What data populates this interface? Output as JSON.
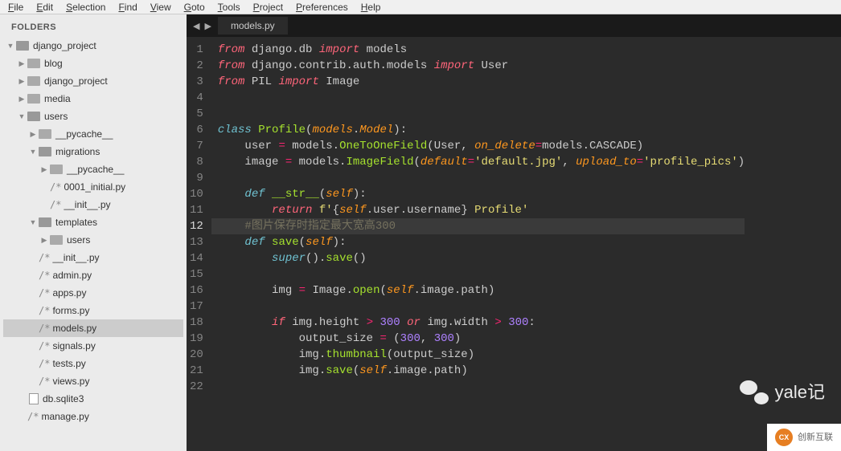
{
  "menu": [
    "File",
    "Edit",
    "Selection",
    "Find",
    "View",
    "Goto",
    "Tools",
    "Project",
    "Preferences",
    "Help"
  ],
  "sidebar": {
    "title": "FOLDERS",
    "tree": [
      {
        "type": "folder",
        "label": "django_project",
        "indent": 0,
        "open": true,
        "arrow": "down"
      },
      {
        "type": "folder",
        "label": "blog",
        "indent": 1,
        "open": false,
        "arrow": "right"
      },
      {
        "type": "folder",
        "label": "django_project",
        "indent": 1,
        "open": false,
        "arrow": "right"
      },
      {
        "type": "folder",
        "label": "media",
        "indent": 1,
        "open": false,
        "arrow": "right"
      },
      {
        "type": "folder",
        "label": "users",
        "indent": 1,
        "open": true,
        "arrow": "down"
      },
      {
        "type": "folder",
        "label": "__pycache__",
        "indent": 2,
        "open": false,
        "arrow": "right"
      },
      {
        "type": "folder",
        "label": "migrations",
        "indent": 2,
        "open": true,
        "arrow": "down"
      },
      {
        "type": "folder",
        "label": "__pycache__",
        "indent": 3,
        "open": false,
        "arrow": "right"
      },
      {
        "type": "file",
        "label": "0001_initial.py",
        "indent": 3,
        "prefix": "/*"
      },
      {
        "type": "file",
        "label": "__init__.py",
        "indent": 3,
        "prefix": "/*"
      },
      {
        "type": "folder",
        "label": "templates",
        "indent": 2,
        "open": true,
        "arrow": "down"
      },
      {
        "type": "folder",
        "label": "users",
        "indent": 3,
        "open": false,
        "arrow": "right"
      },
      {
        "type": "file",
        "label": "__init__.py",
        "indent": 2,
        "prefix": "/*"
      },
      {
        "type": "file",
        "label": "admin.py",
        "indent": 2,
        "prefix": "/*"
      },
      {
        "type": "file",
        "label": "apps.py",
        "indent": 2,
        "prefix": "/*"
      },
      {
        "type": "file",
        "label": "forms.py",
        "indent": 2,
        "prefix": "/*"
      },
      {
        "type": "file",
        "label": "models.py",
        "indent": 2,
        "prefix": "/*",
        "selected": true
      },
      {
        "type": "file",
        "label": "signals.py",
        "indent": 2,
        "prefix": "/*"
      },
      {
        "type": "file",
        "label": "tests.py",
        "indent": 2,
        "prefix": "/*"
      },
      {
        "type": "file",
        "label": "views.py",
        "indent": 2,
        "prefix": "/*"
      },
      {
        "type": "file",
        "label": "db.sqlite3",
        "indent": 1,
        "prefix": "",
        "icon": "file"
      },
      {
        "type": "file",
        "label": "manage.py",
        "indent": 1,
        "prefix": "/*"
      }
    ]
  },
  "tabs": {
    "active": "models.py"
  },
  "code": {
    "lines": [
      {
        "n": 1,
        "tokens": [
          [
            "kw",
            "from"
          ],
          [
            "name",
            " django"
          ],
          [
            "punct",
            "."
          ],
          [
            "name",
            "db"
          ],
          [
            "name",
            " "
          ],
          [
            "kw",
            "import"
          ],
          [
            "name",
            " models"
          ]
        ]
      },
      {
        "n": 2,
        "tokens": [
          [
            "kw",
            "from"
          ],
          [
            "name",
            " django"
          ],
          [
            "punct",
            "."
          ],
          [
            "name",
            "contrib"
          ],
          [
            "punct",
            "."
          ],
          [
            "name",
            "auth"
          ],
          [
            "punct",
            "."
          ],
          [
            "name",
            "models"
          ],
          [
            "name",
            " "
          ],
          [
            "kw",
            "import"
          ],
          [
            "name",
            " User"
          ]
        ]
      },
      {
        "n": 3,
        "tokens": [
          [
            "kw",
            "from"
          ],
          [
            "name",
            " PIL"
          ],
          [
            "name",
            " "
          ],
          [
            "kw",
            "import"
          ],
          [
            "name",
            " Image"
          ]
        ]
      },
      {
        "n": 4,
        "tokens": []
      },
      {
        "n": 5,
        "tokens": []
      },
      {
        "n": 6,
        "tokens": [
          [
            "kw2",
            "class"
          ],
          [
            "name",
            " "
          ],
          [
            "cls",
            "Profile"
          ],
          [
            "punct",
            "("
          ],
          [
            "param",
            "models"
          ],
          [
            "punct",
            "."
          ],
          [
            "param",
            "Model"
          ],
          [
            "punct",
            ")"
          ],
          [
            "punct",
            ":"
          ]
        ]
      },
      {
        "n": 7,
        "tokens": [
          [
            "name",
            "    user "
          ],
          [
            "op",
            "="
          ],
          [
            "name",
            " models"
          ],
          [
            "punct",
            "."
          ],
          [
            "fn",
            "OneToOneField"
          ],
          [
            "punct",
            "("
          ],
          [
            "name",
            "User"
          ],
          [
            "punct",
            ", "
          ],
          [
            "param",
            "on_delete"
          ],
          [
            "op",
            "="
          ],
          [
            "name",
            "models"
          ],
          [
            "punct",
            "."
          ],
          [
            "name",
            "CASCADE"
          ],
          [
            "punct",
            ")"
          ]
        ]
      },
      {
        "n": 8,
        "tokens": [
          [
            "name",
            "    image "
          ],
          [
            "op",
            "="
          ],
          [
            "name",
            " models"
          ],
          [
            "punct",
            "."
          ],
          [
            "fn",
            "ImageField"
          ],
          [
            "punct",
            "("
          ],
          [
            "param",
            "default"
          ],
          [
            "op",
            "="
          ],
          [
            "str",
            "'default.jpg'"
          ],
          [
            "punct",
            ", "
          ],
          [
            "param",
            "upload_to"
          ],
          [
            "op",
            "="
          ],
          [
            "str",
            "'profile_pics'"
          ],
          [
            "punct",
            ")"
          ]
        ]
      },
      {
        "n": 9,
        "tokens": []
      },
      {
        "n": 10,
        "tokens": [
          [
            "name",
            "    "
          ],
          [
            "kw2",
            "def"
          ],
          [
            "name",
            " "
          ],
          [
            "fn",
            "__str__"
          ],
          [
            "punct",
            "("
          ],
          [
            "param",
            "self"
          ],
          [
            "punct",
            ")"
          ],
          [
            "punct",
            ":"
          ]
        ]
      },
      {
        "n": 11,
        "tokens": [
          [
            "name",
            "        "
          ],
          [
            "kw",
            "return"
          ],
          [
            "name",
            " "
          ],
          [
            "str",
            "f'"
          ],
          [
            "punct",
            "{"
          ],
          [
            "param",
            "self"
          ],
          [
            "punct",
            "."
          ],
          [
            "name",
            "user"
          ],
          [
            "punct",
            "."
          ],
          [
            "name",
            "username"
          ],
          [
            "punct",
            "}"
          ],
          [
            "str",
            " Profile'"
          ]
        ]
      },
      {
        "n": 12,
        "cur": true,
        "tokens": [
          [
            "name",
            "    "
          ],
          [
            "comment",
            "#图片保存时指定最大宽高300"
          ]
        ]
      },
      {
        "n": 13,
        "tokens": [
          [
            "name",
            "    "
          ],
          [
            "kw2",
            "def"
          ],
          [
            "name",
            " "
          ],
          [
            "fn",
            "save"
          ],
          [
            "punct",
            "("
          ],
          [
            "param",
            "self"
          ],
          [
            "punct",
            ")"
          ],
          [
            "punct",
            ":"
          ]
        ]
      },
      {
        "n": 14,
        "tokens": [
          [
            "name",
            "        "
          ],
          [
            "builtin",
            "super"
          ],
          [
            "punct",
            "()"
          ],
          [
            "punct",
            "."
          ],
          [
            "fn",
            "save"
          ],
          [
            "punct",
            "()"
          ]
        ]
      },
      {
        "n": 15,
        "tokens": []
      },
      {
        "n": 16,
        "tokens": [
          [
            "name",
            "        img "
          ],
          [
            "op",
            "="
          ],
          [
            "name",
            " Image"
          ],
          [
            "punct",
            "."
          ],
          [
            "fn",
            "open"
          ],
          [
            "punct",
            "("
          ],
          [
            "param",
            "self"
          ],
          [
            "punct",
            "."
          ],
          [
            "name",
            "image"
          ],
          [
            "punct",
            "."
          ],
          [
            "name",
            "path"
          ],
          [
            "punct",
            ")"
          ]
        ]
      },
      {
        "n": 17,
        "tokens": []
      },
      {
        "n": 18,
        "tokens": [
          [
            "name",
            "        "
          ],
          [
            "kw",
            "if"
          ],
          [
            "name",
            " img"
          ],
          [
            "punct",
            "."
          ],
          [
            "name",
            "height"
          ],
          [
            "name",
            " "
          ],
          [
            "op",
            ">"
          ],
          [
            "name",
            " "
          ],
          [
            "num",
            "300"
          ],
          [
            "name",
            " "
          ],
          [
            "kw",
            "or"
          ],
          [
            "name",
            " img"
          ],
          [
            "punct",
            "."
          ],
          [
            "name",
            "width"
          ],
          [
            "name",
            " "
          ],
          [
            "op",
            ">"
          ],
          [
            "name",
            " "
          ],
          [
            "num",
            "300"
          ],
          [
            "punct",
            ":"
          ]
        ]
      },
      {
        "n": 19,
        "tokens": [
          [
            "name",
            "            output_size "
          ],
          [
            "op",
            "="
          ],
          [
            "name",
            " "
          ],
          [
            "punct",
            "("
          ],
          [
            "num",
            "300"
          ],
          [
            "punct",
            ", "
          ],
          [
            "num",
            "300"
          ],
          [
            "punct",
            ")"
          ]
        ]
      },
      {
        "n": 20,
        "tokens": [
          [
            "name",
            "            img"
          ],
          [
            "punct",
            "."
          ],
          [
            "fn",
            "thumbnail"
          ],
          [
            "punct",
            "("
          ],
          [
            "name",
            "output_size"
          ],
          [
            "punct",
            ")"
          ]
        ]
      },
      {
        "n": 21,
        "tokens": [
          [
            "name",
            "            img"
          ],
          [
            "punct",
            "."
          ],
          [
            "fn",
            "save"
          ],
          [
            "punct",
            "("
          ],
          [
            "param",
            "self"
          ],
          [
            "punct",
            "."
          ],
          [
            "name",
            "image"
          ],
          [
            "punct",
            "."
          ],
          [
            "name",
            "path"
          ],
          [
            "punct",
            ")"
          ]
        ]
      },
      {
        "n": 22,
        "tokens": []
      }
    ]
  },
  "watermark": {
    "wechat_text": "yale记",
    "brand_text": "创新互联"
  }
}
